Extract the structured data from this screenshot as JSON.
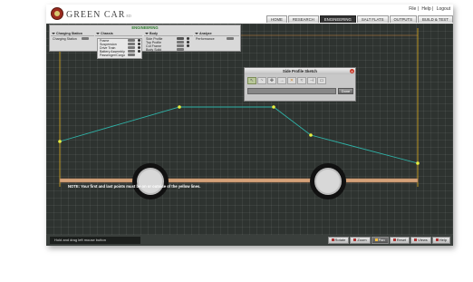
{
  "header": {
    "brand": "GREEN CAR",
    "brand_suffix": "ED",
    "links": [
      "File",
      "Help",
      "Logout"
    ],
    "tabs": [
      "HOME",
      "RESEARCH",
      "ENGINEERING",
      "SALT FLATS",
      "OUTPUTS",
      "BUILD & TEST"
    ],
    "active_tab": "ENGINEERING"
  },
  "engineering_menu": {
    "title": "ENGINEERING",
    "columns": [
      {
        "heading": "Charging Station",
        "items": [
          "Charging Station"
        ]
      },
      {
        "heading": "Chassis",
        "items": [
          "Frame",
          "Suspension",
          "Drive Train",
          "Battery Assembly",
          "Passenger/Cargo"
        ]
      },
      {
        "heading": "Body",
        "items": [
          "Side Profile",
          "Top Profile",
          "Cut Frame",
          "Body Solid"
        ]
      },
      {
        "heading": "Analyze",
        "items": [
          "Performance"
        ]
      }
    ]
  },
  "palette": {
    "title": "Side Profile Sketch",
    "close": "x",
    "tools": [
      "pointer-tool",
      "curve-tool",
      "move-tool",
      "arrow-tool",
      "delete-tool",
      "smooth-tool",
      "line-tool",
      "eraser-tool"
    ],
    "done_label": "Done"
  },
  "canvas": {
    "note": "NOTE: Your first and last points must be on or outside of the yellow lines.",
    "line_color": "#2fb3a8",
    "guide_color": "#e0b020",
    "point_color": "#e8f040",
    "ground_color": "#d4a27a"
  },
  "status": {
    "message": "Hold and drag left mouse button"
  },
  "bottom_tools": [
    {
      "label": "Rotate",
      "active": false
    },
    {
      "label": "Zoom",
      "active": false
    },
    {
      "label": "Pan",
      "active": true
    },
    {
      "label": "Reset",
      "active": false
    },
    {
      "label": "Views",
      "active": false
    },
    {
      "label": "Help",
      "active": false
    }
  ]
}
